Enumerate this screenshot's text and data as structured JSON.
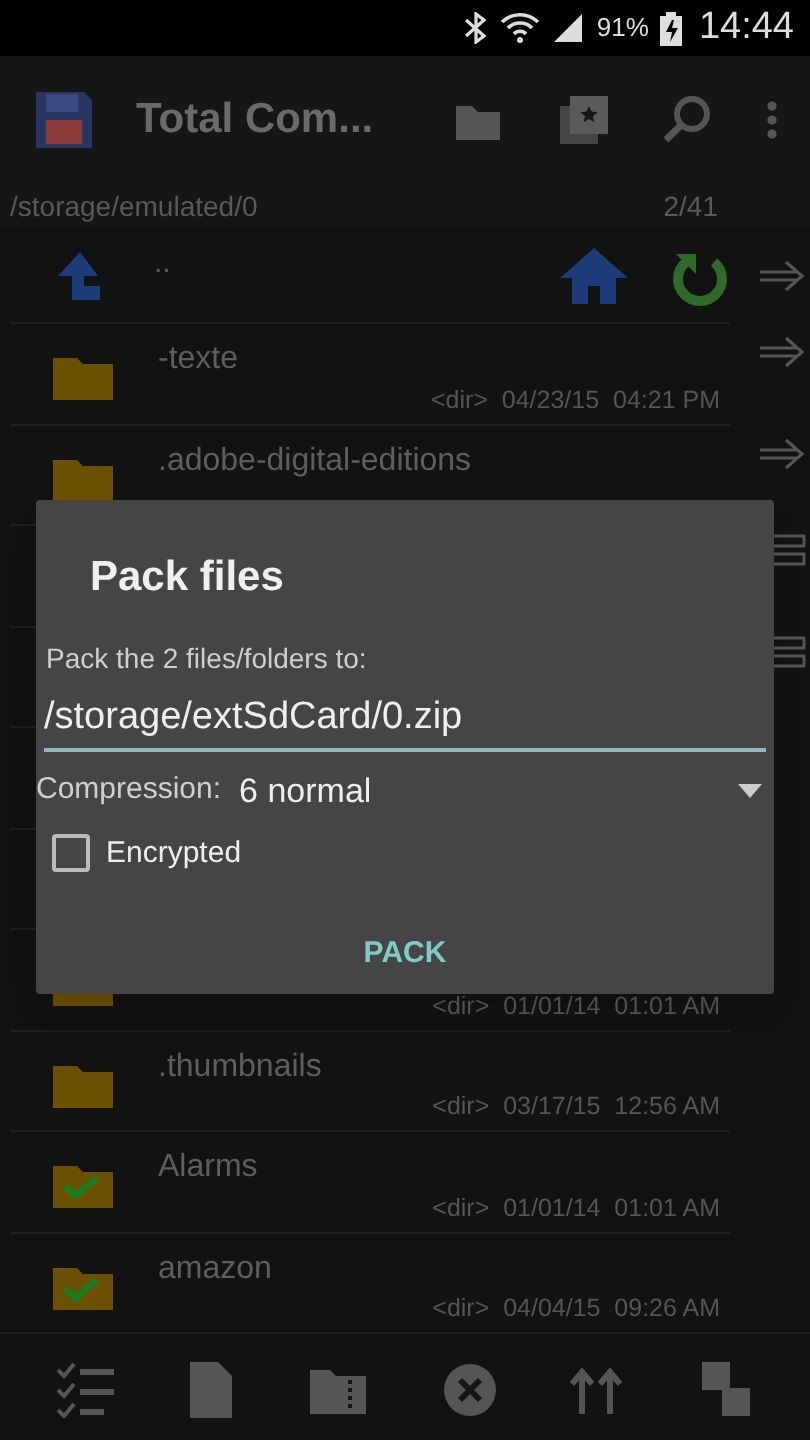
{
  "status_bar": {
    "battery": "91%",
    "time": "14:44"
  },
  "toolbar": {
    "title": "Total Com..."
  },
  "path_bar": {
    "path": "/storage/emulated/0",
    "count": "2/41"
  },
  "parent_row": {
    "name": ".."
  },
  "rows": [
    {
      "name": "-texte",
      "info": "<dir>  04/23/15  04:21 PM",
      "selected": false,
      "kind": "arrow"
    },
    {
      "name": ".adobe-digital-editions",
      "selected": false,
      "kind": "arrow"
    },
    {
      "kind": "lines"
    },
    {
      "kind": "lines"
    },
    {
      "kind": "plain"
    },
    {
      "kind": "plain"
    },
    {
      "info": "<dir>  01/01/14  01:01 AM",
      "selected": false,
      "kind": "plain"
    },
    {
      "name": ".thumbnails",
      "info": "<dir>  03/17/15  12:56 AM",
      "selected": false,
      "kind": "plain"
    },
    {
      "name": "Alarms",
      "info": "<dir>  01/01/14  01:01 AM",
      "selected": true,
      "kind": "plain"
    },
    {
      "name": "amazon",
      "info": "<dir>  04/04/15  09:26 AM",
      "selected": true,
      "kind": "plain"
    }
  ],
  "dialog": {
    "title": "Pack files",
    "prompt": "Pack the 2 files/folders to:",
    "target": "/storage/extSdCard/0.zip",
    "compression_label": "Compression:",
    "compression_value": "6 normal",
    "encrypted": {
      "label": "Encrypted",
      "checked": false
    },
    "button": "PACK"
  }
}
